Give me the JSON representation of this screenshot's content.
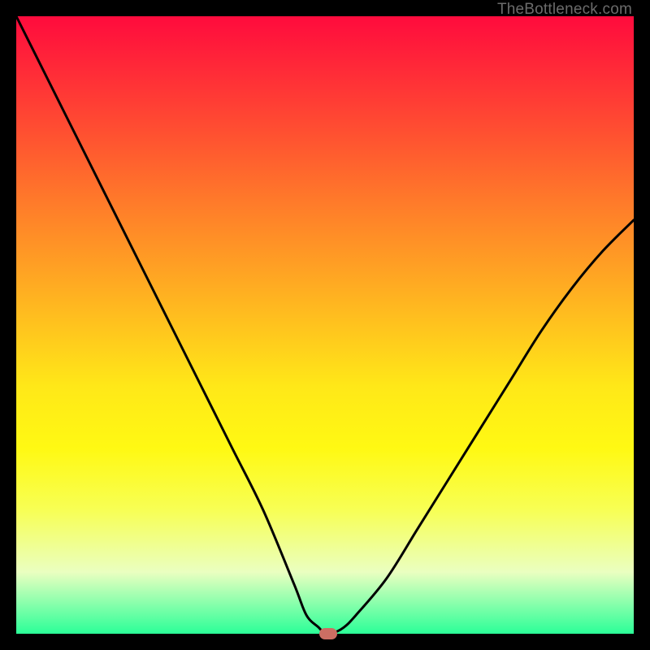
{
  "watermark": "TheBottleneck.com",
  "chart_data": {
    "type": "line",
    "title": "",
    "xlabel": "",
    "ylabel": "",
    "xlim": [
      0,
      100
    ],
    "ylim": [
      0,
      100
    ],
    "grid": false,
    "legend": false,
    "series": [
      {
        "name": "bottleneck-curve",
        "x": [
          0,
          5,
          10,
          15,
          20,
          25,
          30,
          35,
          40,
          45,
          47,
          49,
          50,
          51,
          53,
          55,
          60,
          65,
          70,
          75,
          80,
          85,
          90,
          95,
          100
        ],
        "y": [
          100,
          90,
          80,
          70,
          60,
          50,
          40,
          30,
          20,
          8,
          3,
          1,
          0,
          0,
          1,
          3,
          9,
          17,
          25,
          33,
          41,
          49,
          56,
          62,
          67
        ]
      }
    ],
    "marker": {
      "x": 50.5,
      "y": 0
    },
    "background_gradient": {
      "top": "#ff0b3d",
      "mid": "#ffe818",
      "bottom": "#2bff98"
    }
  }
}
